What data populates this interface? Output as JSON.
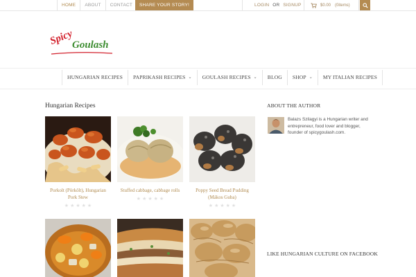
{
  "topbar": {
    "nav": [
      {
        "label": "HOME",
        "active": true
      },
      {
        "label": "ABOUT",
        "active": false
      },
      {
        "label": "CONTACT",
        "active": false
      }
    ],
    "share_label": "SHARE YOUR STORY!",
    "login_label": "LOGIN",
    "or_label": "OR",
    "signup_label": "SIGNUP",
    "cart_amount": "$0.00",
    "cart_items": "(0items)"
  },
  "logo": {
    "line1": "Spicy",
    "line2": "Goulash"
  },
  "main_nav": [
    {
      "label": "HUNGARIAN RECIPES",
      "has_dropdown": false
    },
    {
      "label": "PAPRIKASH RECIPES",
      "has_dropdown": true
    },
    {
      "label": "GOULASH RECIPES",
      "has_dropdown": true
    },
    {
      "label": "BLOG",
      "has_dropdown": false
    },
    {
      "label": "SHOP",
      "has_dropdown": true
    },
    {
      "label": "MY ITALIAN RECIPES",
      "has_dropdown": false
    }
  ],
  "content": {
    "title": "Hungarian Recipes",
    "recipes": [
      {
        "title": "Porkolt (Pörkölt), Hungarian Pork Stew",
        "rating": 0,
        "max_rating": 5
      },
      {
        "title": "Stuffed cabbage, cabbage rolls",
        "rating": 0,
        "max_rating": 5
      },
      {
        "title": "Poppy Seed Bread Pudding (Mákos Guba)",
        "rating": 0,
        "max_rating": 5
      },
      {
        "title": "",
        "rating": 0,
        "max_rating": 5
      },
      {
        "title": "",
        "rating": 0,
        "max_rating": 5
      },
      {
        "title": "",
        "rating": 0,
        "max_rating": 5
      }
    ]
  },
  "sidebar": {
    "about_heading": "ABOUT THE AUTHOR",
    "about_text": "Balazs Szilagyi is a Hungarian writer and entrepreneur, food lover and blogger, founder of spicygoulash.com.",
    "facebook_heading": "LIKE HUNGARIAN CULTURE ON FACEBOOK"
  },
  "colors": {
    "accent": "#b48b52",
    "link": "#b08a4e",
    "logo_red": "#d21f2b",
    "logo_green": "#3b8c2f"
  }
}
